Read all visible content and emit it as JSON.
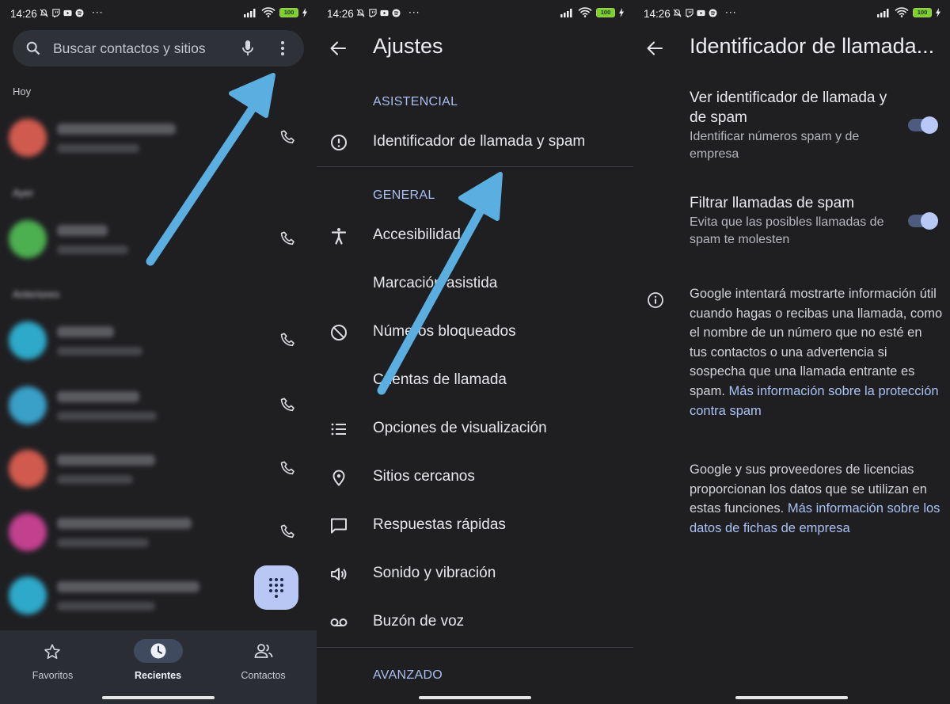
{
  "status": {
    "time": "14:26",
    "dots": "···",
    "battery": "100"
  },
  "screen1": {
    "search_placeholder": "Buscar contactos y sitios",
    "sections": [
      "Hoy",
      "Ayer",
      "Anteriores"
    ],
    "nav": [
      {
        "label": "Favoritos",
        "icon": "star-icon"
      },
      {
        "label": "Recientes",
        "icon": "clock-icon"
      },
      {
        "label": "Contactos",
        "icon": "contacts-icon"
      }
    ],
    "avatar_colors": [
      "#d05a4e",
      "#4caf50",
      "#2ea9c9",
      "#3aa0c8",
      "#d05a4e",
      "#c2418f",
      "#2ea9c9"
    ]
  },
  "screen2": {
    "title": "Ajustes",
    "cat_asistencial": "ASISTENCIAL",
    "cat_general": "GENERAL",
    "cat_avanzado": "AVANZADO",
    "items": [
      {
        "label": "Identificador de llamada y spam",
        "icon": "alert-circle-icon"
      },
      {
        "label": "Accesibilidad",
        "icon": "accessibility-icon"
      },
      {
        "label": "Marcación asistida",
        "icon": ""
      },
      {
        "label": "Números bloqueados",
        "icon": "block-icon"
      },
      {
        "label": "Cuentas de llamada",
        "icon": ""
      },
      {
        "label": "Opciones de visualización",
        "icon": "list-icon"
      },
      {
        "label": "Sitios cercanos",
        "icon": "location-icon"
      },
      {
        "label": "Respuestas rápidas",
        "icon": "message-icon"
      },
      {
        "label": "Sonido y vibración",
        "icon": "volume-icon"
      },
      {
        "label": "Buzón de voz",
        "icon": "voicemail-icon"
      }
    ]
  },
  "screen3": {
    "title": "Identificador de llamada...",
    "pref1_title": "Ver identificador de llamada y de spam",
    "pref1_sub": "Identificar números spam y de empresa",
    "pref2_title": "Filtrar llamadas de spam",
    "pref2_sub": "Evita que las posibles llamadas de spam te molesten",
    "info_text": "Google intentará mostrarte información útil cuando hagas o recibas una llamada, como el nombre de un número que no esté en tus contactos o una advertencia si sospecha que una llamada entrante es spam.",
    "info_link": "Más información sobre la protección contra spam",
    "license_text": "Google y sus proveedores de licencias proporcionan los datos que se utilizan en estas funciones.",
    "license_link": "Más información sobre los datos de fichas de empresa"
  },
  "colors": {
    "background": "#1f1f22",
    "accent": "#a9c1f3",
    "annotation_arrow": "#5aaee0"
  }
}
